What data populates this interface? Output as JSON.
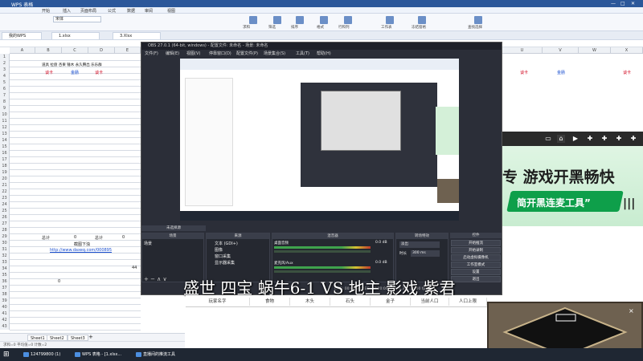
{
  "wps": {
    "app_title": "WPS 表格",
    "menu": [
      "开始",
      "插入",
      "页面布局",
      "公式",
      "数据",
      "审阅",
      "视图"
    ],
    "font_name": "宋体",
    "ribbon_labels": [
      "求和",
      "筛选",
      "排序",
      "格式",
      "行和列",
      "工作表",
      "冻结窗格",
      "查找选择"
    ],
    "tabs": [
      "我的WPS",
      "1.xlsx",
      "3.Xlsx"
    ],
    "columns": [
      "A",
      "B",
      "C",
      "D",
      "E"
    ],
    "right_columns": [
      "U",
      "V",
      "W",
      "X"
    ],
    "headers_row2": "道具 拉盘 杏果 锤木 永久腾出 乐乐群",
    "labels_row3": [
      "谈卡",
      "金肠",
      "谈卡"
    ],
    "row29": {
      "label1": "总计",
      "v1": "0",
      "label2": "总计",
      "v2": "0"
    },
    "row30": "截图下浊",
    "row31_link": "http://www.daxeq.com/000895",
    "val_44": "44",
    "val_0": "0",
    "sheets": [
      "Sheet1",
      "Sheet2",
      "Sheet3"
    ],
    "status": "求和=0  平均值=0  计数=2"
  },
  "obs": {
    "title": "OBS 27.0.1 (64-bit, windows) - 配置文件: 未命名 - 场景: 未命名",
    "menu": [
      "文件(F)",
      "编辑(E)",
      "视图(V)",
      "停靠窗口(D)",
      "配置文件(P)",
      "场景集合(S)",
      "工具(T)",
      "帮助(H)"
    ],
    "panels": {
      "scenes": "场景",
      "sources": "来源",
      "mixer": "混音器",
      "transitions": "转场特效",
      "controls": "控件"
    },
    "no_source": "未选择源",
    "scene_item": "场景",
    "sources": [
      "文本 (GDI+)",
      "图像",
      "窗口采集",
      "显示器采集"
    ],
    "mixer_tracks": [
      {
        "name": "桌面音频",
        "db": "0.0 dB"
      },
      {
        "name": "麦克风/Aux",
        "db": "0.0 dB"
      }
    ],
    "transition": {
      "type": "淡出",
      "duration_label": "时长",
      "duration": "300 ms"
    },
    "controls": [
      "开始推流",
      "开始录制",
      "启动虚拟摄像机",
      "工作室模式",
      "设置",
      "退出"
    ],
    "status": "LIVE: 00:00:00  REC: 00:00:00  CPU: 4.3%, 30.00 fps",
    "subtitle": "盛世 四宝 蜗牛6-1 VS 地主 影戏 紫君"
  },
  "bottom_table": {
    "headers": [
      "玩家名字",
      "食物",
      "木头",
      "石头",
      "金子",
      "当前人口",
      "人口上限"
    ]
  },
  "ad": {
    "big_text": "专 游戏开黑畅快",
    "sub_text": "简开黑连麦工具”",
    "bars": "|||"
  },
  "taskbar": {
    "items": [
      "124799800 (1)",
      "WPS 表格 - [1.xlsx...",
      "直播间的推流工具"
    ]
  },
  "colors": {
    "wps_blue": "#2b579a",
    "obs_bg": "#2b2e38",
    "ad_green": "#0e9f4a",
    "link_blue": "#1a4fd0"
  }
}
